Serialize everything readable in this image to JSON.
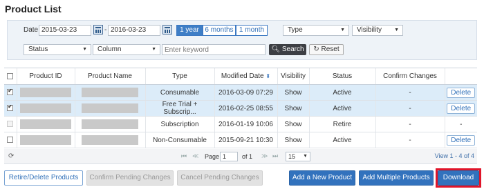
{
  "page_title": "Product List",
  "filter": {
    "date_label": "Date",
    "date_from": "2015-03-23",
    "date_sep": "-",
    "date_to": "2016-03-23",
    "ranges": [
      "1 year",
      "6 months",
      "1 month"
    ],
    "active_range": "1 year",
    "type_select": "Type",
    "visibility_select": "Visibility",
    "status_select": "Status",
    "column_select": "Column",
    "keyword_placeholder": "Enter keyword",
    "search_label": "Search",
    "reset_label": "Reset"
  },
  "table": {
    "headers": [
      "Product ID",
      "Product Name",
      "Type",
      "Modified Date",
      "Visibility",
      "Status",
      "Confirm Changes"
    ],
    "sort_glyph": "⬍",
    "rows": [
      {
        "checked": true,
        "type": "Consumable",
        "modified": "2016-03-09 07:29",
        "visibility": "Show",
        "status": "Active",
        "confirm": "-",
        "action": "Delete"
      },
      {
        "checked": true,
        "type": "Free Trial + Subscrip...",
        "modified": "2016-02-25 08:55",
        "visibility": "Show",
        "status": "Active",
        "confirm": "-",
        "action": "Delete"
      },
      {
        "checked": false,
        "type": "Subscription",
        "modified": "2016-01-19 10:06",
        "visibility": "Show",
        "status": "Retire",
        "confirm": "-",
        "action": "-"
      },
      {
        "checked": false,
        "type": "Non-Consumable",
        "modified": "2015-09-21 10:30",
        "visibility": "Show",
        "status": "Active",
        "confirm": "-",
        "action": "Delete"
      }
    ]
  },
  "pager": {
    "page_label": "Page",
    "page_value": "1",
    "of_label": "of 1",
    "page_size": "15",
    "view_summary": "View 1 - 4 of 4"
  },
  "actions": {
    "retire_delete": "Retire/Delete Products",
    "confirm_pending": "Confirm Pending Changes",
    "cancel_pending": "Cancel Pending Changes",
    "add_new": "Add a New Product",
    "add_multiple": "Add Multiple Products",
    "download": "Download"
  },
  "colors": {
    "accent": "#3272bd",
    "highlight": "#e0152a",
    "selected_row": "#dcecf9"
  }
}
